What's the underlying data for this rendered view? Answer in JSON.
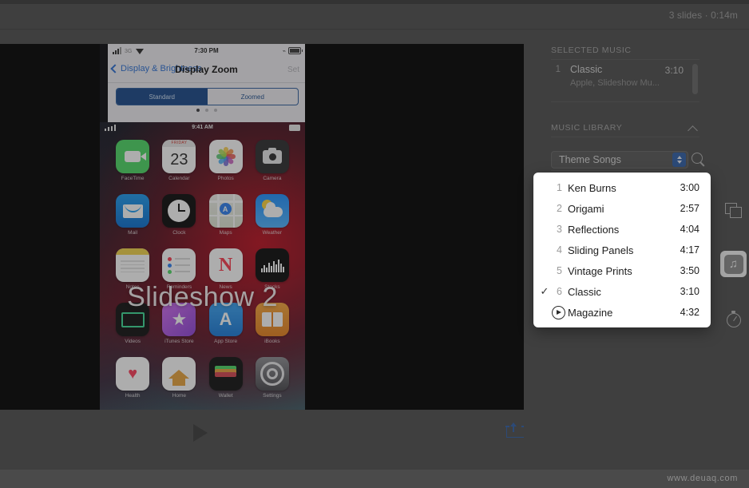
{
  "window": {
    "slides_meta": "3 slides · 0:14m"
  },
  "canvas": {
    "slide": {
      "caption": "Slideshow 2",
      "settings_screen": {
        "status_time": "7:30 PM",
        "carrier": "3G",
        "back_label": "Display & Brightness",
        "title": "Display Zoom",
        "set_label": "Set",
        "segments": [
          {
            "label": "Standard",
            "selected": true
          },
          {
            "label": "Zoomed",
            "selected": false
          }
        ]
      },
      "home_screen": {
        "status_time": "9:41 AM",
        "apps": [
          {
            "name": "FaceTime"
          },
          {
            "name": "Calendar",
            "day": "23",
            "month": "FRIDAY"
          },
          {
            "name": "Photos"
          },
          {
            "name": "Camera"
          },
          {
            "name": "Mail"
          },
          {
            "name": "Clock"
          },
          {
            "name": "Maps"
          },
          {
            "name": "Weather"
          },
          {
            "name": "Notes"
          },
          {
            "name": "Reminders"
          },
          {
            "name": "News"
          },
          {
            "name": "Stocks"
          },
          {
            "name": "Videos"
          },
          {
            "name": "iTunes Store"
          },
          {
            "name": "App Store"
          },
          {
            "name": "iBooks"
          },
          {
            "name": "Health"
          },
          {
            "name": "Home"
          },
          {
            "name": "Wallet"
          },
          {
            "name": "Settings"
          }
        ]
      }
    }
  },
  "toolbar": {
    "play_label": "Play",
    "export_label": "Export"
  },
  "inspector": {
    "selected_music": {
      "title": "SELECTED MUSIC",
      "track": {
        "index": "1",
        "name": "Classic",
        "artist": "Apple, Slideshow Mu...",
        "duration": "3:10"
      }
    },
    "music_library": {
      "title": "MUSIC LIBRARY",
      "collapse_label": "Collapse",
      "source_select": {
        "value": "Theme Songs"
      },
      "search_label": "Search"
    }
  },
  "dropdown": {
    "items": [
      {
        "index": "1",
        "label": "Ken Burns",
        "duration": "3:00",
        "checked": false,
        "hovered": false
      },
      {
        "index": "2",
        "label": "Origami",
        "duration": "2:57",
        "checked": false,
        "hovered": false
      },
      {
        "index": "3",
        "label": "Reflections",
        "duration": "4:04",
        "checked": false,
        "hovered": false
      },
      {
        "index": "4",
        "label": "Sliding Panels",
        "duration": "4:17",
        "checked": false,
        "hovered": false
      },
      {
        "index": "5",
        "label": "Vintage Prints",
        "duration": "3:50",
        "checked": false,
        "hovered": false
      },
      {
        "index": "6",
        "label": "Classic",
        "duration": "3:10",
        "checked": true,
        "hovered": false
      },
      {
        "index": "7",
        "label": "Magazine",
        "duration": "4:32",
        "checked": false,
        "hovered": true
      }
    ],
    "check_glyph": "✓"
  },
  "rail": {
    "slides_label": "Slides",
    "music_label": "Music",
    "timer_label": "Timing",
    "music_glyph": "♫"
  },
  "footer": {
    "watermark": "www.deuaq.com"
  },
  "colors": {
    "accent_blue": "#2f5fa8",
    "panel_bg": "#4e4e4e",
    "popup_bg": "#ffffff"
  }
}
